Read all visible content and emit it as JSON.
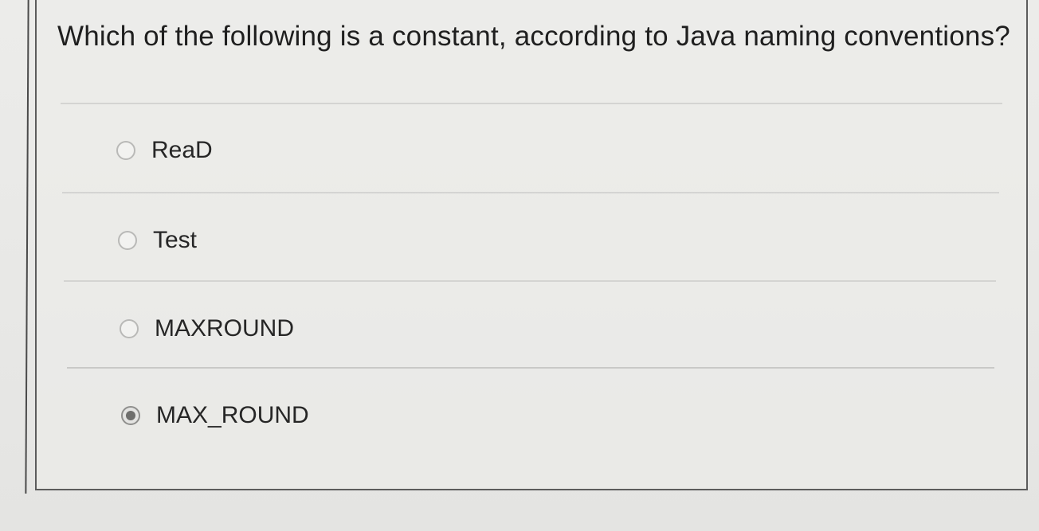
{
  "question": {
    "text": "Which of the following is a constant, according to Java naming conventions?"
  },
  "options": [
    {
      "label": "ReaD",
      "selected": false
    },
    {
      "label": "Test",
      "selected": false
    },
    {
      "label": "MAXROUND",
      "selected": false
    },
    {
      "label": "MAX_ROUND",
      "selected": true
    }
  ],
  "colors": {
    "background": "#e9e9e7",
    "text": "#1f1f1f",
    "divider": "#d4d4d2",
    "border": "#5c5c5c"
  }
}
